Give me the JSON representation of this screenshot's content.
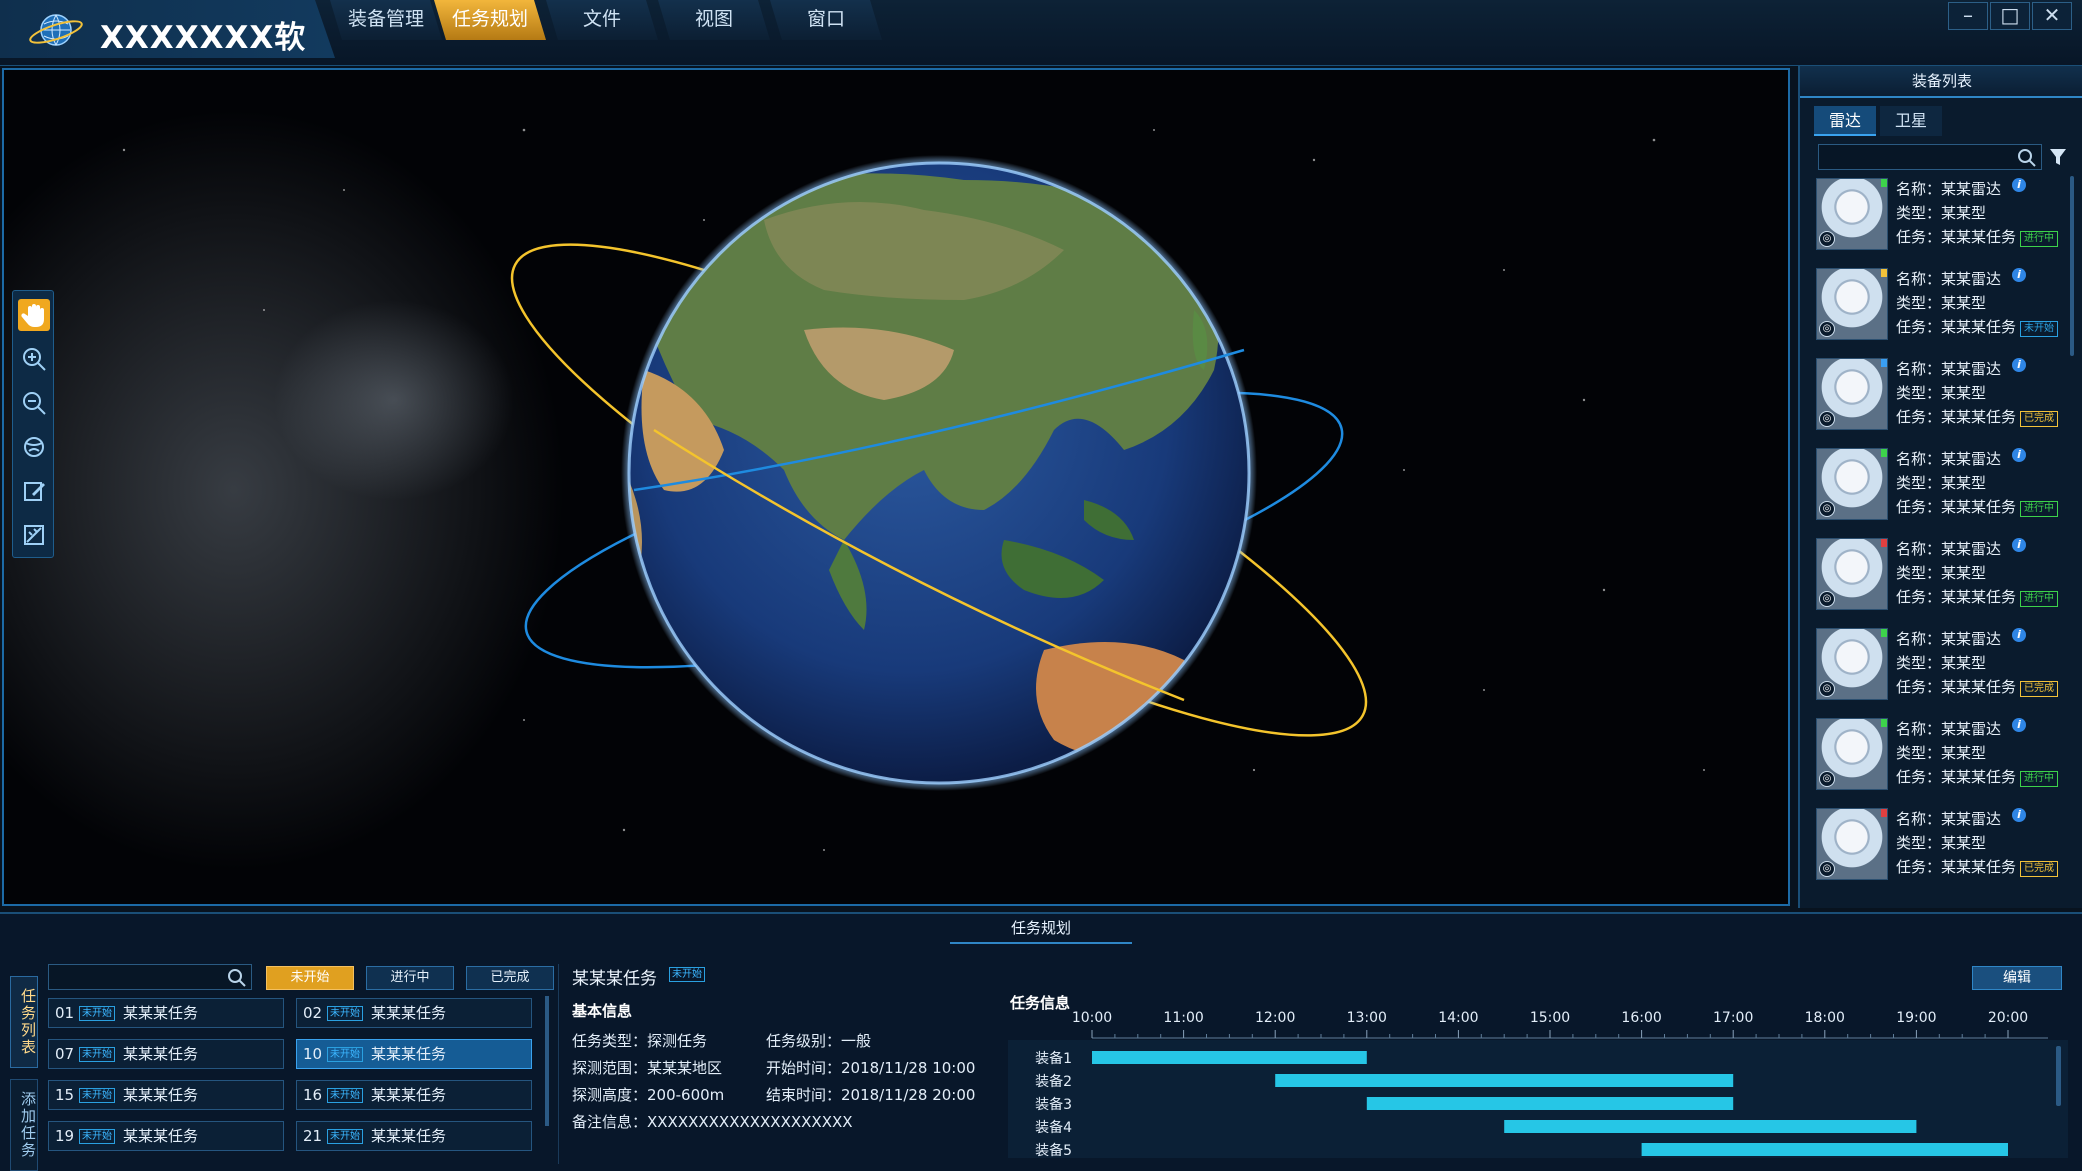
{
  "app": {
    "title": "XXXXXXX软件"
  },
  "menu": [
    "装备管理",
    "任务规划",
    "文件",
    "视图",
    "窗口"
  ],
  "menu_active": 1,
  "window_controls": {
    "minimize": "–",
    "maximize": "□",
    "close": "✕"
  },
  "toolbar": [
    {
      "icon": "hand-pan-icon",
      "active": true
    },
    {
      "icon": "zoom-in-icon",
      "active": false
    },
    {
      "icon": "zoom-out-icon",
      "active": false
    },
    {
      "icon": "globe-reset-icon",
      "active": false
    },
    {
      "icon": "edit-icon",
      "active": false
    },
    {
      "icon": "measure-icon",
      "active": false
    }
  ],
  "equipment_panel": {
    "title": "装备列表",
    "tabs": [
      "雷达",
      "卫星"
    ],
    "active_tab": 0,
    "items": [
      {
        "name": "名称：某某雷达",
        "type": "类型：某某型",
        "task": "任务：某某某任务",
        "status": "进行中",
        "flag": "#3dd24b"
      },
      {
        "name": "名称：某某雷达",
        "type": "类型：某某型",
        "task": "任务：某某某任务",
        "status": "未开始",
        "flag": "#f3c23a"
      },
      {
        "name": "名称：某某雷达",
        "type": "类型：某某型",
        "task": "任务：某某某任务",
        "status": "已完成",
        "flag": "#3a9ff3"
      },
      {
        "name": "名称：某某雷达",
        "type": "类型：某某型",
        "task": "任务：某某某任务",
        "status": "进行中",
        "flag": "#3dd24b"
      },
      {
        "name": "名称：某某雷达",
        "type": "类型：某某型",
        "task": "任务：某某某任务",
        "status": "进行中",
        "flag": "#e04040"
      },
      {
        "name": "名称：某某雷达",
        "type": "类型：某某型",
        "task": "任务：某某某任务",
        "status": "已完成",
        "flag": "#3dd24b"
      },
      {
        "name": "名称：某某雷达",
        "type": "类型：某某型",
        "task": "任务：某某某任务",
        "status": "进行中",
        "flag": "#3dd24b"
      },
      {
        "name": "名称：某某雷达",
        "type": "类型：某某型",
        "task": "任务：某某某任务",
        "status": "已完成",
        "flag": "#e04040"
      }
    ]
  },
  "status_colors": {
    "进行中": "#3dd24b",
    "未开始": "#2aa0e0",
    "已完成": "#f3c23a"
  },
  "task_panel": {
    "title": "任务规划",
    "side_tabs": [
      "任务列表",
      "添加任务"
    ],
    "filters": [
      "未开始",
      "进行中",
      "已完成"
    ],
    "active_filter": 0,
    "tasks": [
      {
        "id": "01",
        "badge": "未开始",
        "name": "某某某任务"
      },
      {
        "id": "02",
        "badge": "未开始",
        "name": "某某某任务"
      },
      {
        "id": "07",
        "badge": "未开始",
        "name": "某某某任务"
      },
      {
        "id": "10",
        "badge": "未开始",
        "name": "某某某任务",
        "selected": true
      },
      {
        "id": "15",
        "badge": "未开始",
        "name": "某某某任务"
      },
      {
        "id": "16",
        "badge": "未开始",
        "name": "某某某任务"
      },
      {
        "id": "19",
        "badge": "未开始",
        "name": "某某某任务"
      },
      {
        "id": "21",
        "badge": "未开始",
        "name": "某某某任务"
      }
    ]
  },
  "task_detail": {
    "name": "某某某任务",
    "badge": "未开始",
    "section": "基本信息",
    "type": "任务类型：探测任务",
    "level": "任务级别：一般",
    "range": "探测范围：某某某地区",
    "start": "开始时间：2018/11/28 10:00",
    "height": "探测高度：200-600m",
    "end": "结束时间：2018/11/28 20:00",
    "note": "备注信息：XXXXXXXXXXXXXXXXXXXX"
  },
  "timeline": {
    "title": "任务信息",
    "edit_label": "编辑",
    "hours": [
      "10:00",
      "11:00",
      "12:00",
      "13:00",
      "14:00",
      "15:00",
      "16:00",
      "17:00",
      "18:00",
      "19:00",
      "20:00"
    ],
    "equipment": [
      {
        "name": "装备1",
        "start": 10.0,
        "end": 13.0
      },
      {
        "name": "装备2",
        "start": 12.0,
        "end": 17.0
      },
      {
        "name": "装备3",
        "start": 13.0,
        "end": 17.0
      },
      {
        "name": "装备4",
        "start": 14.5,
        "end": 19.0
      },
      {
        "name": "装备5",
        "start": 16.0,
        "end": 20.0
      }
    ],
    "bar_color": "#26c6e6"
  }
}
